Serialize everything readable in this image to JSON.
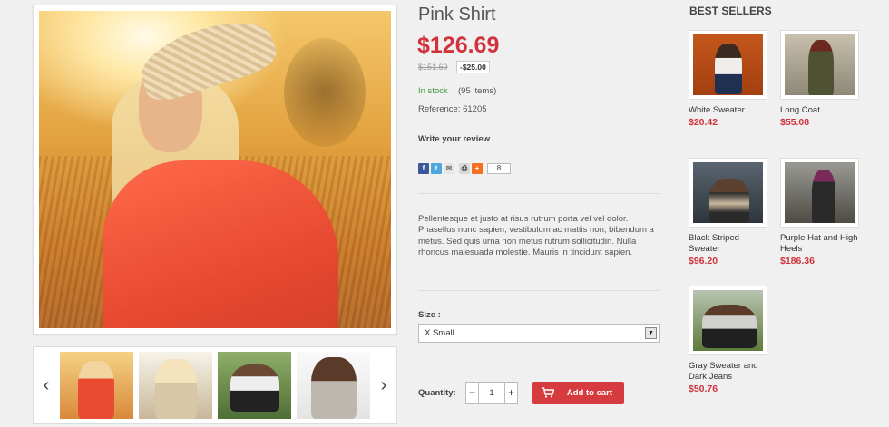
{
  "product": {
    "title": "Pink Shirt",
    "price": "$126.69",
    "old_price": "$151.69",
    "discount": "-$25.00",
    "stock_status": "In stock",
    "stock_count": "(95 items)",
    "reference": "Reference: 61205",
    "review_link": "Write your review",
    "share_count": "8",
    "description": "Pellentesque et justo at risus rutrum porta vel vel dolor. Phasellus nunc sapien, vestibulum ac mattis non, bibendum a metus. Sed quis urna non metus rutrum sollicitudin. Nulla rhoncus malesuada molestie. Mauris in tincidunt sapien.",
    "size_label": "Size :",
    "size_selected": "X Small",
    "quantity_label": "Quantity:",
    "quantity_value": "1",
    "add_to_cart": "Add to cart"
  },
  "gallery": {
    "prev_arrow": "‹",
    "next_arrow": "›",
    "thumbnail_count": 4
  },
  "best_sellers": {
    "title": "BEST SELLERS",
    "items": [
      {
        "name": "White Sweater",
        "price": "$20.42"
      },
      {
        "name": "Long Coat",
        "price": "$55.08"
      },
      {
        "name": "Black Striped Sweater",
        "price": "$96.20"
      },
      {
        "name": "Purple Hat and High Heels",
        "price": "$186.36"
      },
      {
        "name": "Gray Sweater and Dark Jeans",
        "price": "$50.76"
      }
    ]
  },
  "colors": {
    "price_red": "#d0333c",
    "in_stock_green": "#3a9a3a",
    "button_red": "#d63b3f"
  },
  "icons": [
    "facebook-icon",
    "twitter-icon",
    "mail-icon",
    "print-icon",
    "google-plus-icon",
    "cart-icon",
    "caret-down-icon"
  ]
}
